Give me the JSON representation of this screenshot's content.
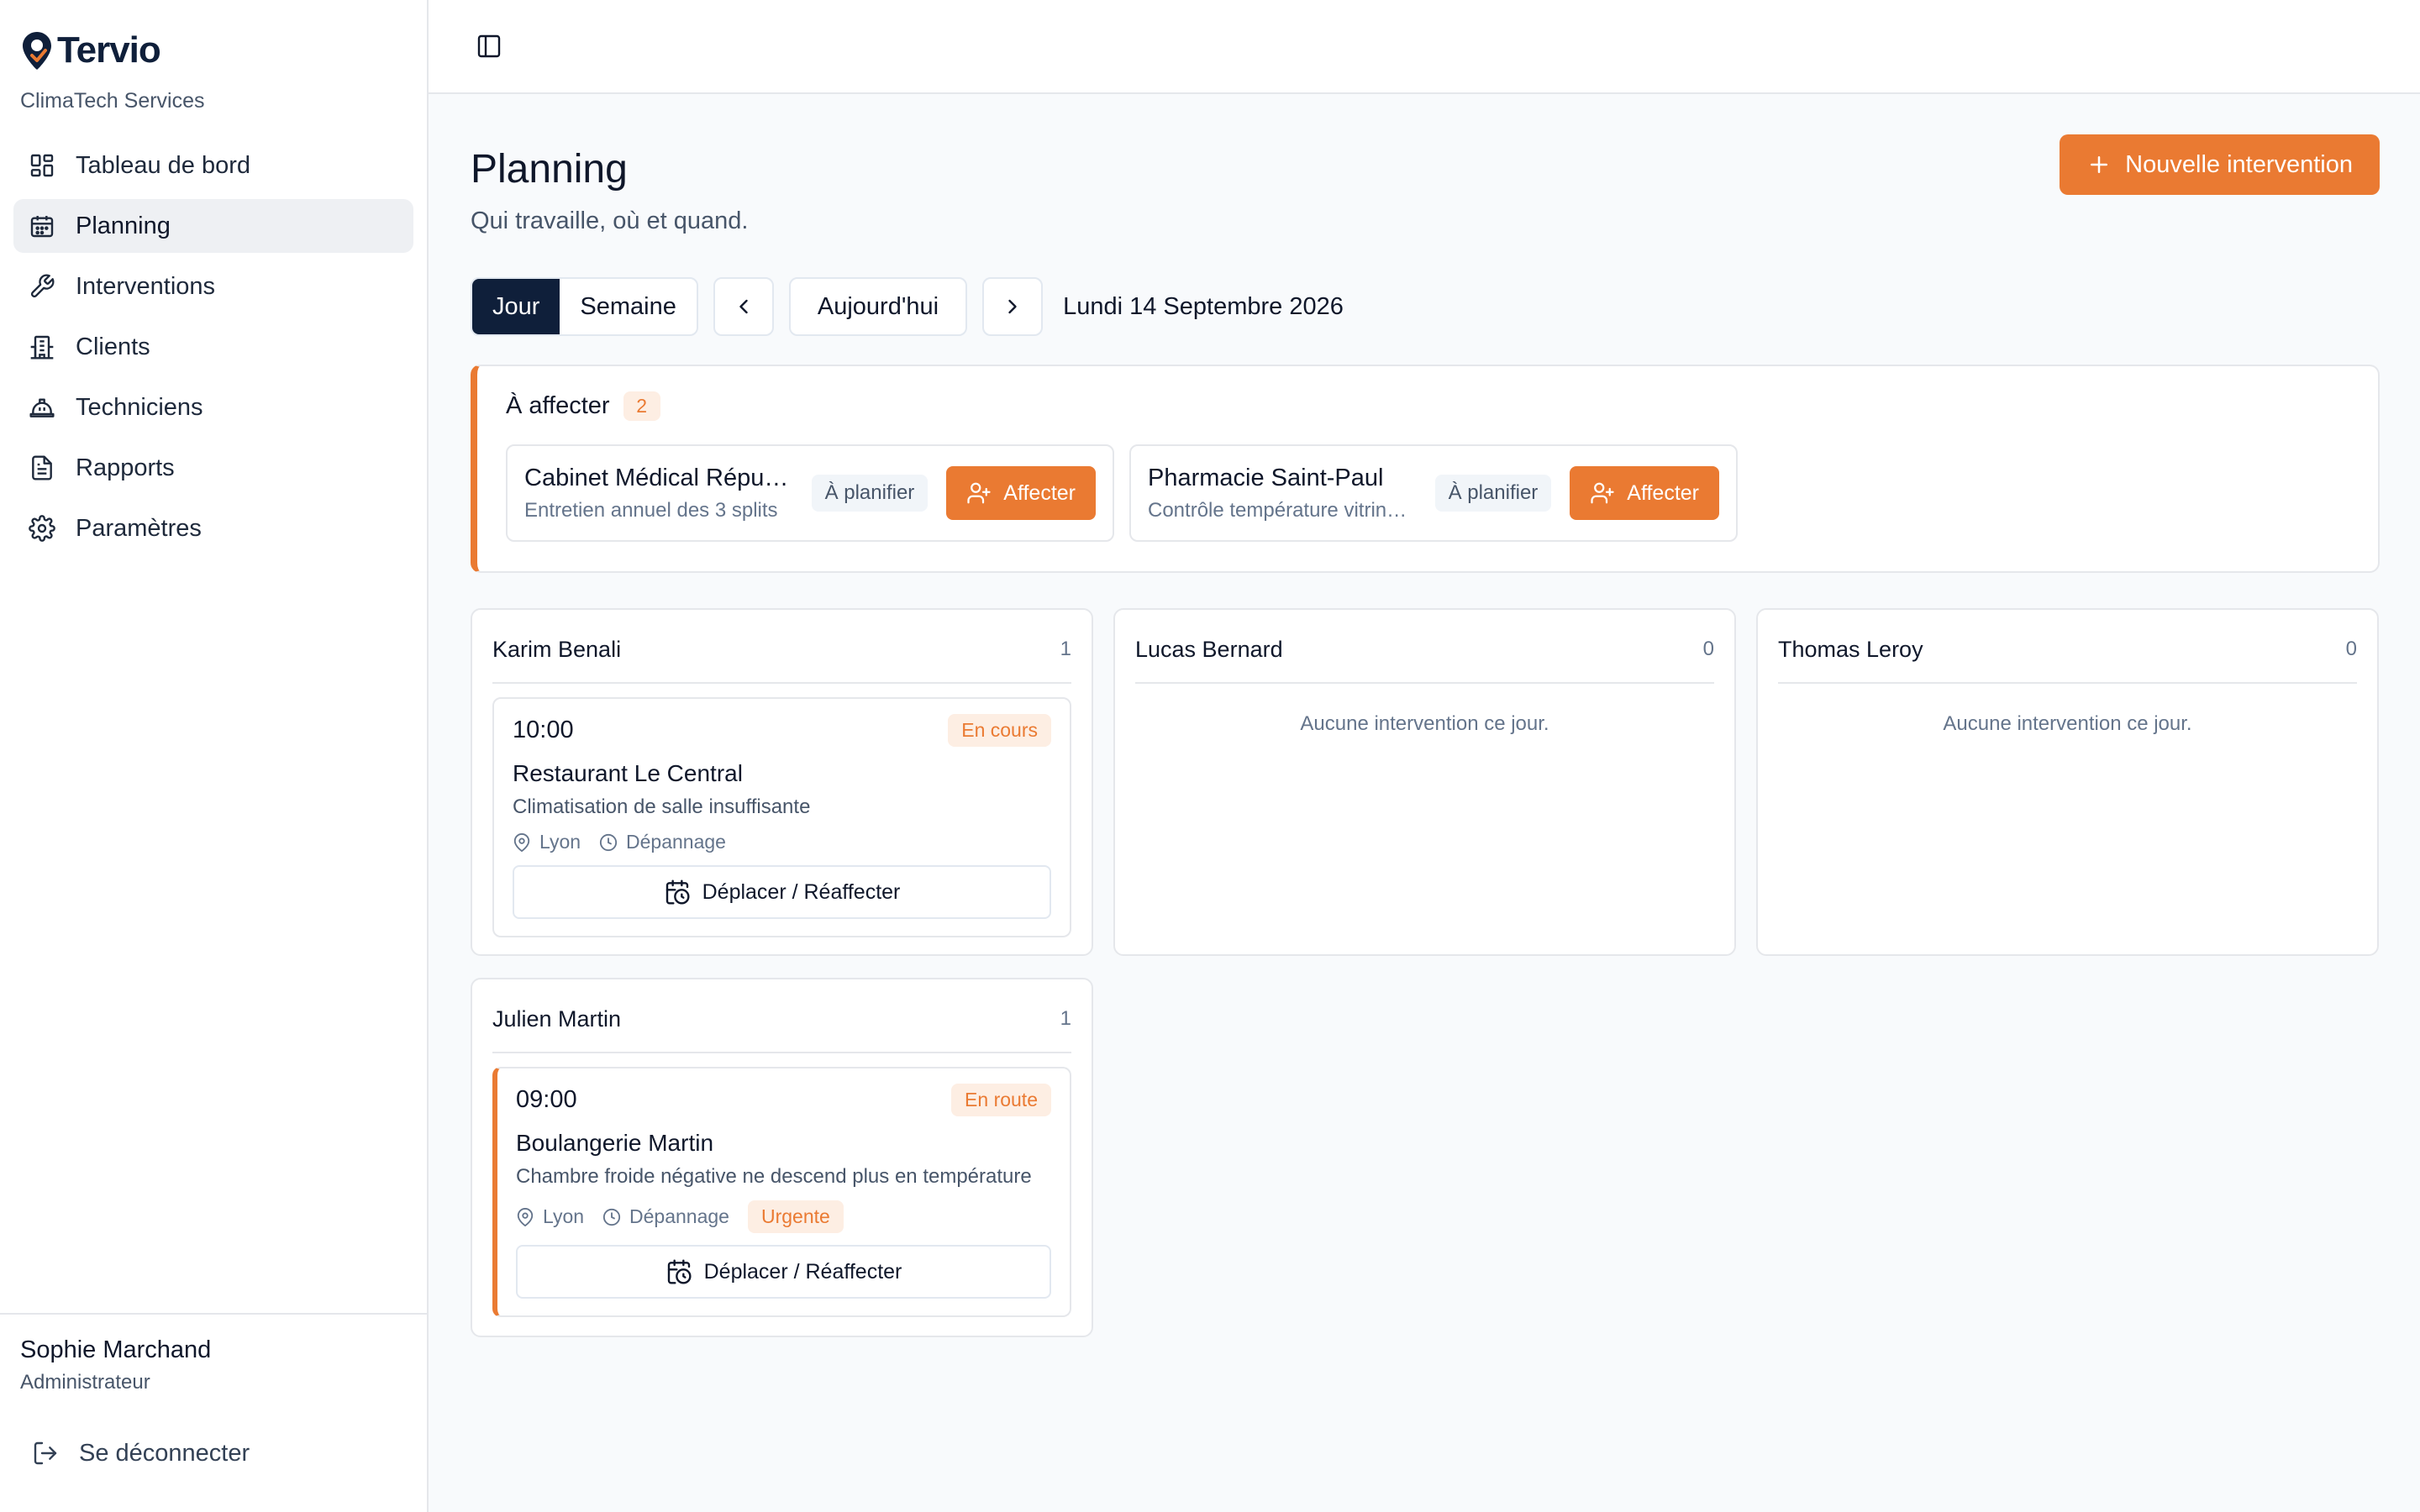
{
  "app": {
    "brand": "Tervio",
    "organization": "ClimaTech Services"
  },
  "sidebar": {
    "items": [
      {
        "label": "Tableau de bord",
        "icon": "dashboard-icon",
        "active": false
      },
      {
        "label": "Planning",
        "icon": "calendar-icon",
        "active": true
      },
      {
        "label": "Interventions",
        "icon": "wrench-icon",
        "active": false
      },
      {
        "label": "Clients",
        "icon": "building-icon",
        "active": false
      },
      {
        "label": "Techniciens",
        "icon": "hardhat-icon",
        "active": false
      },
      {
        "label": "Rapports",
        "icon": "document-icon",
        "active": false
      },
      {
        "label": "Paramètres",
        "icon": "gear-icon",
        "active": false
      }
    ],
    "user": {
      "name": "Sophie Marchand",
      "role": "Administrateur"
    },
    "logout_label": "Se déconnecter"
  },
  "header": {
    "title": "Planning",
    "subtitle": "Qui travaille, où et quand.",
    "new_button": "Nouvelle intervention"
  },
  "controls": {
    "view_day": "Jour",
    "view_week": "Semaine",
    "today": "Aujourd'hui",
    "date": "Lundi 14 Septembre 2026"
  },
  "unassigned": {
    "title": "À affecter",
    "count": "2",
    "items": [
      {
        "name": "Cabinet Médical République",
        "desc": "Entretien annuel des 3 splits",
        "status": "À planifier",
        "action": "Affecter"
      },
      {
        "name": "Pharmacie Saint-Paul",
        "desc": "Contrôle température vitrine réfrigérée",
        "status": "À planifier",
        "action": "Affecter"
      }
    ]
  },
  "technicians": [
    {
      "name": "Karim Benali",
      "count": "1",
      "jobs": [
        {
          "time": "10:00",
          "status": "En cours",
          "client": "Restaurant Le Central",
          "desc": "Climatisation de salle insuffisante",
          "city": "Lyon",
          "type": "Dépannage",
          "action": "Déplacer / Réaffecter"
        }
      ]
    },
    {
      "name": "Lucas Bernard",
      "count": "0",
      "empty": "Aucune intervention ce jour."
    },
    {
      "name": "Thomas Leroy",
      "count": "0",
      "empty": "Aucune intervention ce jour."
    },
    {
      "name": "Julien Martin",
      "count": "1",
      "jobs": [
        {
          "time": "09:00",
          "status": "En route",
          "client": "Boulangerie Martin",
          "desc": "Chambre froide négative ne descend plus en température",
          "city": "Lyon",
          "type": "Dépannage",
          "priority": "Urgente",
          "action": "Déplacer / Réaffecter"
        }
      ]
    }
  ],
  "colors": {
    "accent": "#ea7a32",
    "navy": "#0f1f3a",
    "border": "#e5e7eb"
  }
}
